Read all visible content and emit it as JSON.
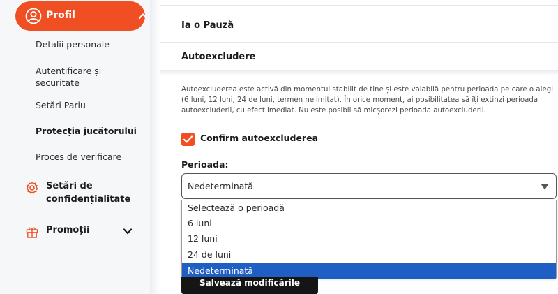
{
  "sidebar": {
    "profile": {
      "label": "Profil"
    },
    "items": [
      {
        "label": "Detalii personale"
      },
      {
        "label": "Autentificare și securitate"
      },
      {
        "label": "Setări Pariu"
      },
      {
        "label": "Protecția jucătorului"
      },
      {
        "label": "Proces de verificare"
      }
    ],
    "sections": [
      {
        "label": "Setări de confidențialitate",
        "icon": "gear-icon"
      },
      {
        "label": "Promoții",
        "icon": "gift-icon"
      }
    ]
  },
  "main": {
    "rows": [
      {
        "title": "Ia o Pauză"
      },
      {
        "title": "Autoexcludere"
      }
    ],
    "description": "Autoexcluderea este activă din momentul stabilit de tine și este valabilă pentru perioada pe care o alegi (6 luni, 12 luni, 24 de luni, termen nelimitat). În orice moment, ai posibilitatea să îți extinzi perioada autoexcluderii, cu efect imediat. Nu este posibil să micșorezi perioada autoexcluderii.",
    "confirm_label": "Confirm autoexcluderea",
    "confirm_checked": true,
    "period_label": "Perioada:",
    "select_value": "Nedeterminată",
    "options": [
      "Selectează o perioadă",
      "6 luni",
      "12 luni",
      "24 de luni",
      "Nedeterminată"
    ],
    "selected_option_index": 4,
    "save_label": "Salvează modificările"
  },
  "colors": {
    "accent": "#f04e23",
    "selected_option": "#1f5fc4",
    "button": "#151515"
  }
}
